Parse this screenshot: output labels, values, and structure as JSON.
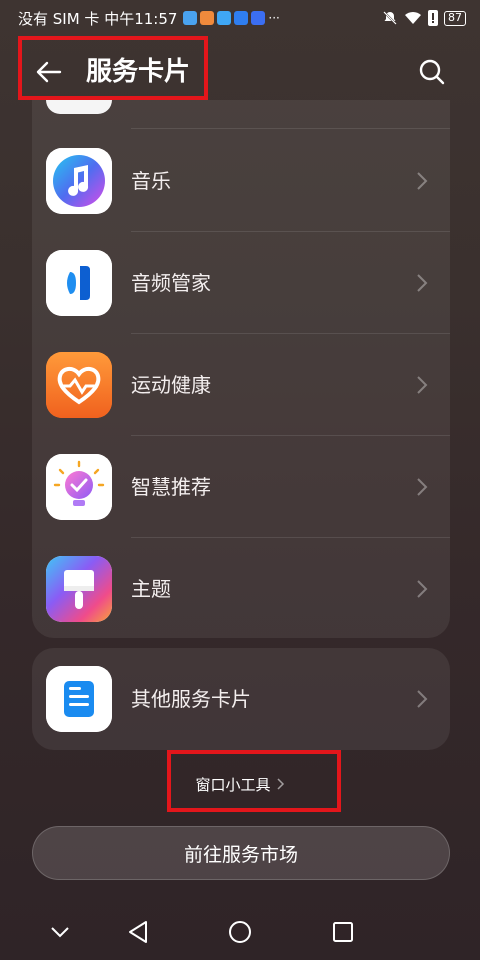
{
  "status_bar": {
    "carrier_time": "没有 SIM 卡 中午11:57",
    "battery": "87",
    "notification_colors": [
      "#4aa3f0",
      "#f08a3c",
      "#3fa7f5",
      "#2f7ef0",
      "#3b6ef2"
    ]
  },
  "header": {
    "title": "服务卡片",
    "back_icon": "back-arrow-icon",
    "search_icon": "search-icon"
  },
  "cards": {
    "main": [
      {
        "label": "音乐",
        "icon": "music-icon"
      },
      {
        "label": "音频管家",
        "icon": "audio-manager-icon"
      },
      {
        "label": "运动健康",
        "icon": "health-icon"
      },
      {
        "label": "智慧推荐",
        "icon": "smart-recommend-icon"
      },
      {
        "label": "主题",
        "icon": "theme-icon"
      }
    ],
    "other": {
      "label": "其他服务卡片",
      "icon": "other-cards-icon"
    }
  },
  "window_tools": {
    "label": "窗口小工具"
  },
  "market_button": {
    "label": "前往服务市场"
  },
  "nav": {
    "icons": [
      "chevron-down-icon",
      "back-triangle-icon",
      "home-circle-icon",
      "recent-square-icon"
    ]
  },
  "colors": {
    "highlight": "#e3161b"
  }
}
